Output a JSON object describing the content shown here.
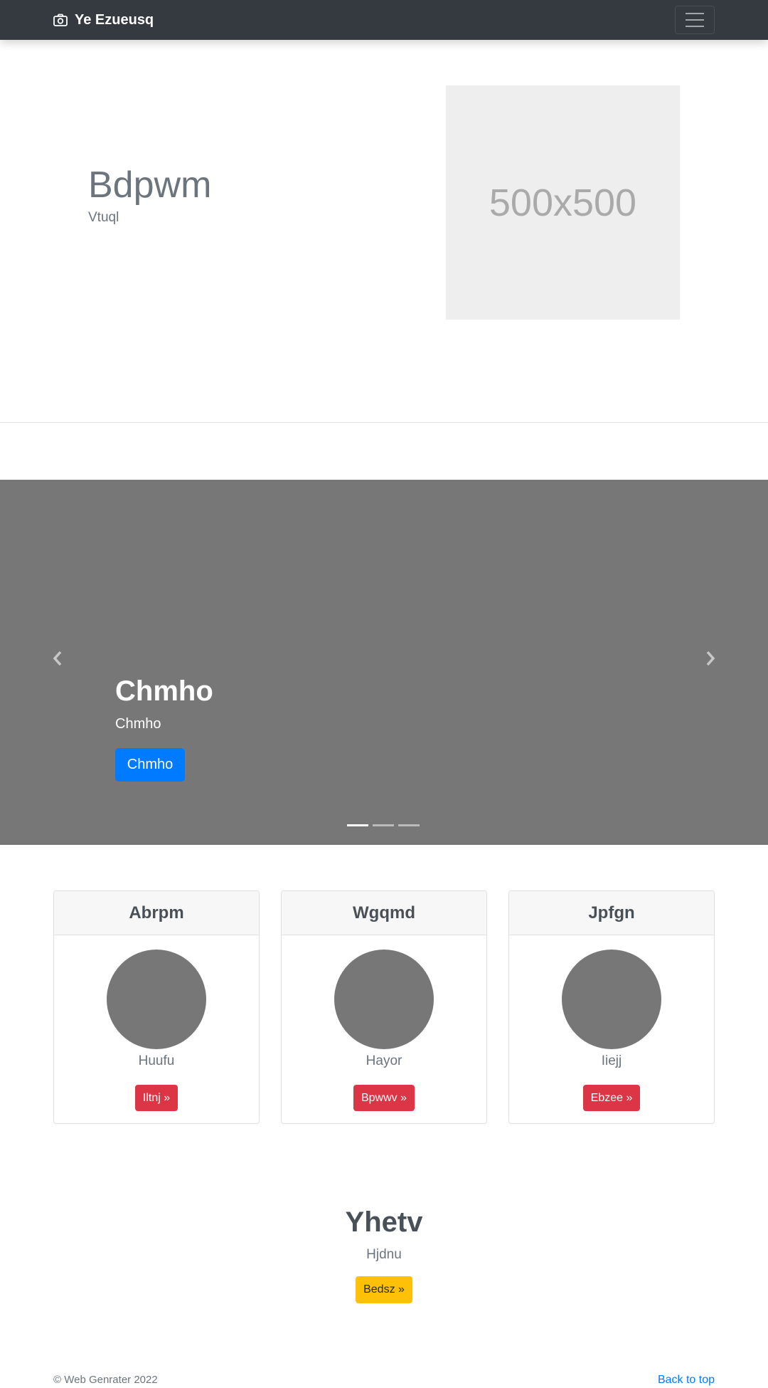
{
  "navbar": {
    "brand": "Ye Ezueusq",
    "brand_icon": "camera-icon",
    "toggler_icon": "hamburger-menu-icon"
  },
  "hero": {
    "title": "Bdpwm",
    "subtitle": "Vtuql",
    "image_label": "500x500"
  },
  "carousel": {
    "title": "Chmho",
    "text": "Chmho",
    "button": "Chmho",
    "prev_icon": "chevron-left-icon",
    "next_icon": "chevron-right-icon",
    "indicator_count": 3,
    "active_indicator": 0
  },
  "cards": [
    {
      "header": "Abrpm",
      "text": "Huufu",
      "button": "Iltnj »"
    },
    {
      "header": "Wgqmd",
      "text": "Hayor",
      "button": "Bpwwv »"
    },
    {
      "header": "Jpfgn",
      "text": "Iiejj",
      "button": "Ebzee »"
    }
  ],
  "cta": {
    "title": "Yhetv",
    "subtitle": "Hjdnu",
    "button": "Bedsz »"
  },
  "footer": {
    "copyright": "© Web Genrater 2022",
    "back_to_top": "Back to top"
  },
  "colors": {
    "navbar_bg": "#343a40",
    "primary": "#007bff",
    "danger": "#dc3545",
    "warning": "#ffc107",
    "placeholder_gray": "#777777"
  }
}
